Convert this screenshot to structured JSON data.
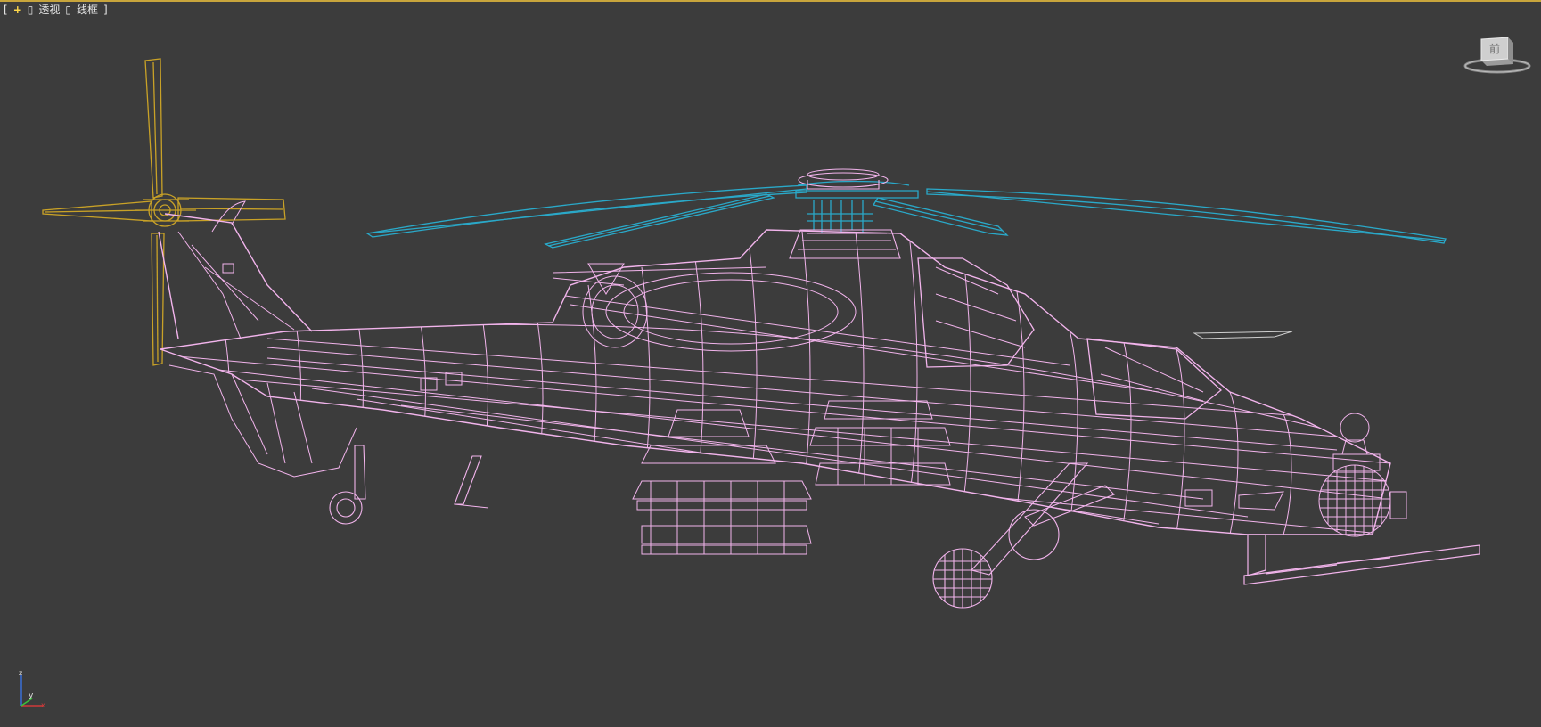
{
  "viewport": {
    "label": {
      "open_bracket": "[",
      "plus": "+",
      "box1": "▯",
      "view": "透视",
      "box2": "▯",
      "shading": "线框",
      "close_bracket": "]"
    },
    "viewcube": {
      "face_label": "前"
    },
    "axis": {
      "x": "x",
      "y": "y",
      "z": "z"
    }
  },
  "colors": {
    "background": "#3c3c3c",
    "active_border": "#c8a53c",
    "fuselage_wire": "#f2b4ec",
    "main_rotor_wire": "#2aa9c9",
    "tail_rotor_wire": "#c9a227"
  }
}
